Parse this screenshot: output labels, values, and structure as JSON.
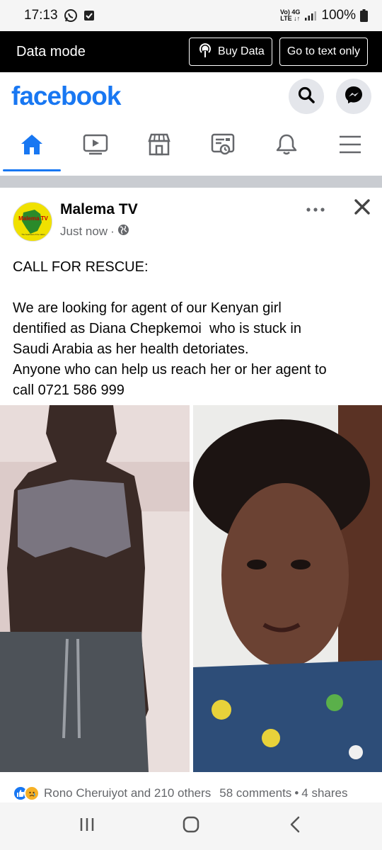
{
  "status_bar": {
    "time": "17:13",
    "network_top": "Vo) 4G",
    "network_bottom": "LTE ↓↑",
    "battery": "100%"
  },
  "data_mode": {
    "title": "Data mode",
    "buy_data_label": "Buy Data",
    "text_only_label": "Go to text only"
  },
  "header": {
    "logo_text": "facebook",
    "brand_color": "#1877f2",
    "icons": [
      "search-icon",
      "messenger-icon"
    ]
  },
  "nav_tabs": [
    {
      "icon": "home-icon",
      "active": true
    },
    {
      "icon": "video-icon",
      "active": false
    },
    {
      "icon": "marketplace-icon",
      "active": false
    },
    {
      "icon": "news-icon",
      "active": false
    },
    {
      "icon": "bell-icon",
      "active": false
    },
    {
      "icon": "menu-icon",
      "active": false
    }
  ],
  "post": {
    "page_name": "Malema TV",
    "avatar_logo_text": "Malema TV",
    "avatar_tagline": "The heartbeat of the nation",
    "timestamp": "Just now",
    "separator": "·",
    "audience_icon": "globe-icon",
    "lines": [
      "CALL FOR RESCUE:",
      "",
      "We are looking for agent of our Kenyan girl",
      "dentified as Diana Chepkemoi  who is stuck in",
      "Saudi Arabia as her health detoriates.",
      "Anyone who can help us reach her or her agent to",
      "call 0721 586 999"
    ],
    "reactions": [
      "like-icon",
      "sad-icon"
    ],
    "reactors_text": "Rono Cheruiyot and 210 others",
    "comments_text": "58 comments",
    "dot": "•",
    "shares_text": "4 shares"
  },
  "system_nav": [
    "recents-icon",
    "home-circle-icon",
    "back-icon"
  ]
}
